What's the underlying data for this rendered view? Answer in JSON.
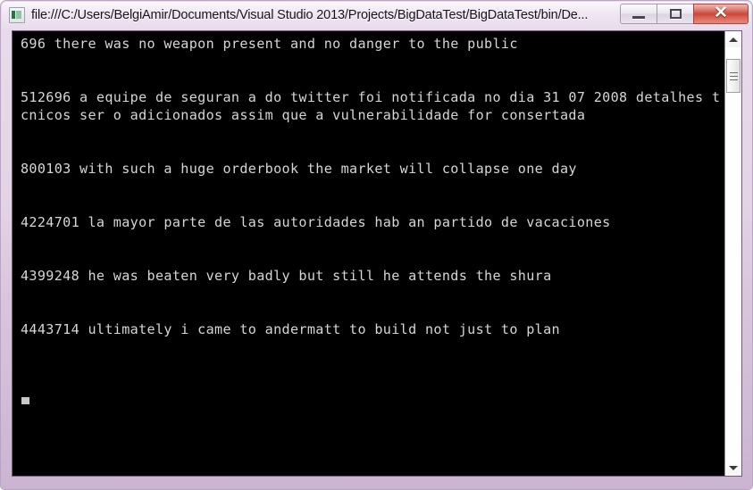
{
  "window": {
    "title": "file:///C:/Users/BelgiAmir/Documents/Visual Studio 2013/Projects/BigDataTest/BigDataTest/bin/De...",
    "icon_name": "console-app-icon",
    "buttons": {
      "minimize_label": "–",
      "maximize_label": "□",
      "close_label": "✕"
    },
    "colors": {
      "frame": "#d9c6dd",
      "frame_border": "#b9a4c1",
      "close_button": "#c8453a",
      "console_background": "#000000",
      "console_text": "#d6d6d6"
    }
  },
  "console": {
    "lines": [
      "696 there was no weapon present and no danger to the public",
      "",
      "",
      "512696 a equipe de seguran a do twitter foi notificada no dia 31 07 2008 detalhes t cnicos ser o adicionados assim que a vulnerabilidade for consertada",
      "",
      "",
      "800103 with such a huge orderbook the market will collapse one day",
      "",
      "",
      "4224701 la mayor parte de las autoridades hab an partido de vacaciones",
      "",
      "",
      "4399248 he was beaten very badly but still he attends the shura",
      "",
      "",
      "4443714 ultimately i came to andermatt to build not just to plan",
      "",
      "",
      ""
    ],
    "cursor_visible": true
  },
  "scrollbar": {
    "up_arrow_name": "scroll-up-arrow",
    "down_arrow_name": "scroll-down-arrow",
    "thumb_position_percent": 3
  }
}
